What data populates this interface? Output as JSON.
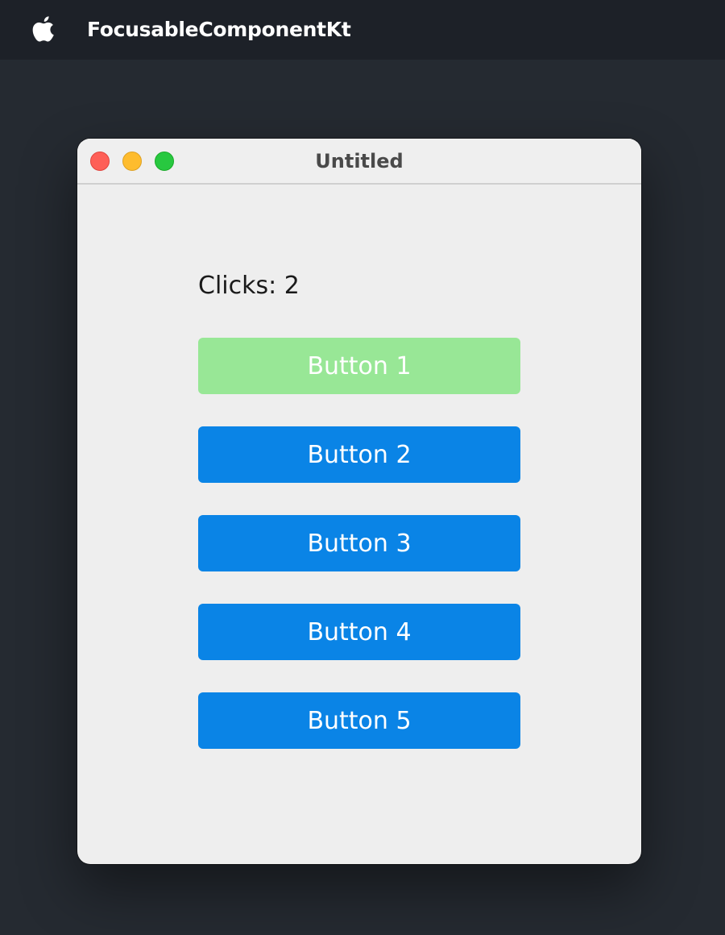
{
  "menubar": {
    "apple_icon": "apple-logo-icon",
    "app_name": "FocusableComponentKt"
  },
  "window": {
    "title": "Untitled",
    "controls": [
      "close",
      "minimize",
      "maximize"
    ]
  },
  "content": {
    "clicks_label": "Clicks: 2",
    "buttons": [
      {
        "label": "Button 1",
        "color": "#98e796",
        "state": "focused"
      },
      {
        "label": "Button 2",
        "color": "#0a84e6"
      },
      {
        "label": "Button 3",
        "color": "#0a84e6"
      },
      {
        "label": "Button 4",
        "color": "#0a84e6"
      },
      {
        "label": "Button 5",
        "color": "#0a84e6"
      }
    ]
  },
  "colors": {
    "desktop": "#252a31",
    "menubar": "#1d2128",
    "window_bg": "#eeeeee",
    "accent_blue": "#0a84e6",
    "focused_green": "#98e796"
  }
}
